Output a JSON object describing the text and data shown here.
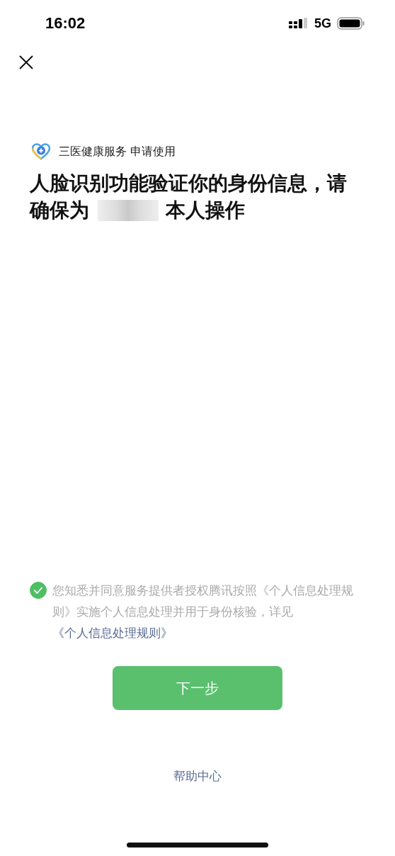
{
  "status_bar": {
    "time": "16:02",
    "network": "5G"
  },
  "app": {
    "name": "三医健康服务 申请使用"
  },
  "heading": {
    "line1": "人脸识别功能验证你的身份信息，请",
    "before": "确保为",
    "after": "本人操作"
  },
  "consent": {
    "checked": true,
    "text": "您知悉并同意服务提供者授权腾讯按照《个人信息处理规则》实施个人信息处理并用于身份核验，详见",
    "link": "《个人信息处理规则》"
  },
  "next_button": {
    "label": "下一步"
  },
  "help_link": {
    "label": "帮助中心"
  }
}
